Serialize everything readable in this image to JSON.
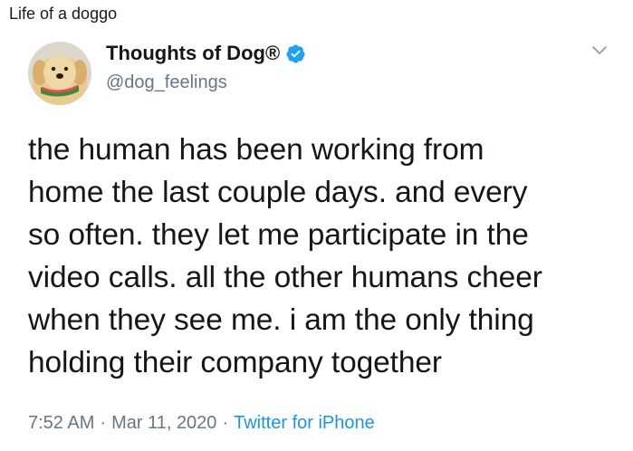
{
  "post": {
    "title": "Life of a doggo"
  },
  "tweet": {
    "display_name": "Thoughts of Dog®",
    "handle": "@dog_feelings",
    "verified": true,
    "avatar_icon": "dog-avatar-icon",
    "text": "the human has been working from\nhome the last couple days. and every\nso often. they let me participate in the\nvideo calls. all the other humans cheer\nwhen they see me. i am the only thing\nholding their company together",
    "time": "7:52 AM",
    "date": "Mar 11, 2020",
    "separator": "·",
    "source": "Twitter for iPhone"
  },
  "colors": {
    "text": "#14171a",
    "secondary": "#657786",
    "accent": "#1b95e0",
    "verified": "#1da1f2"
  }
}
